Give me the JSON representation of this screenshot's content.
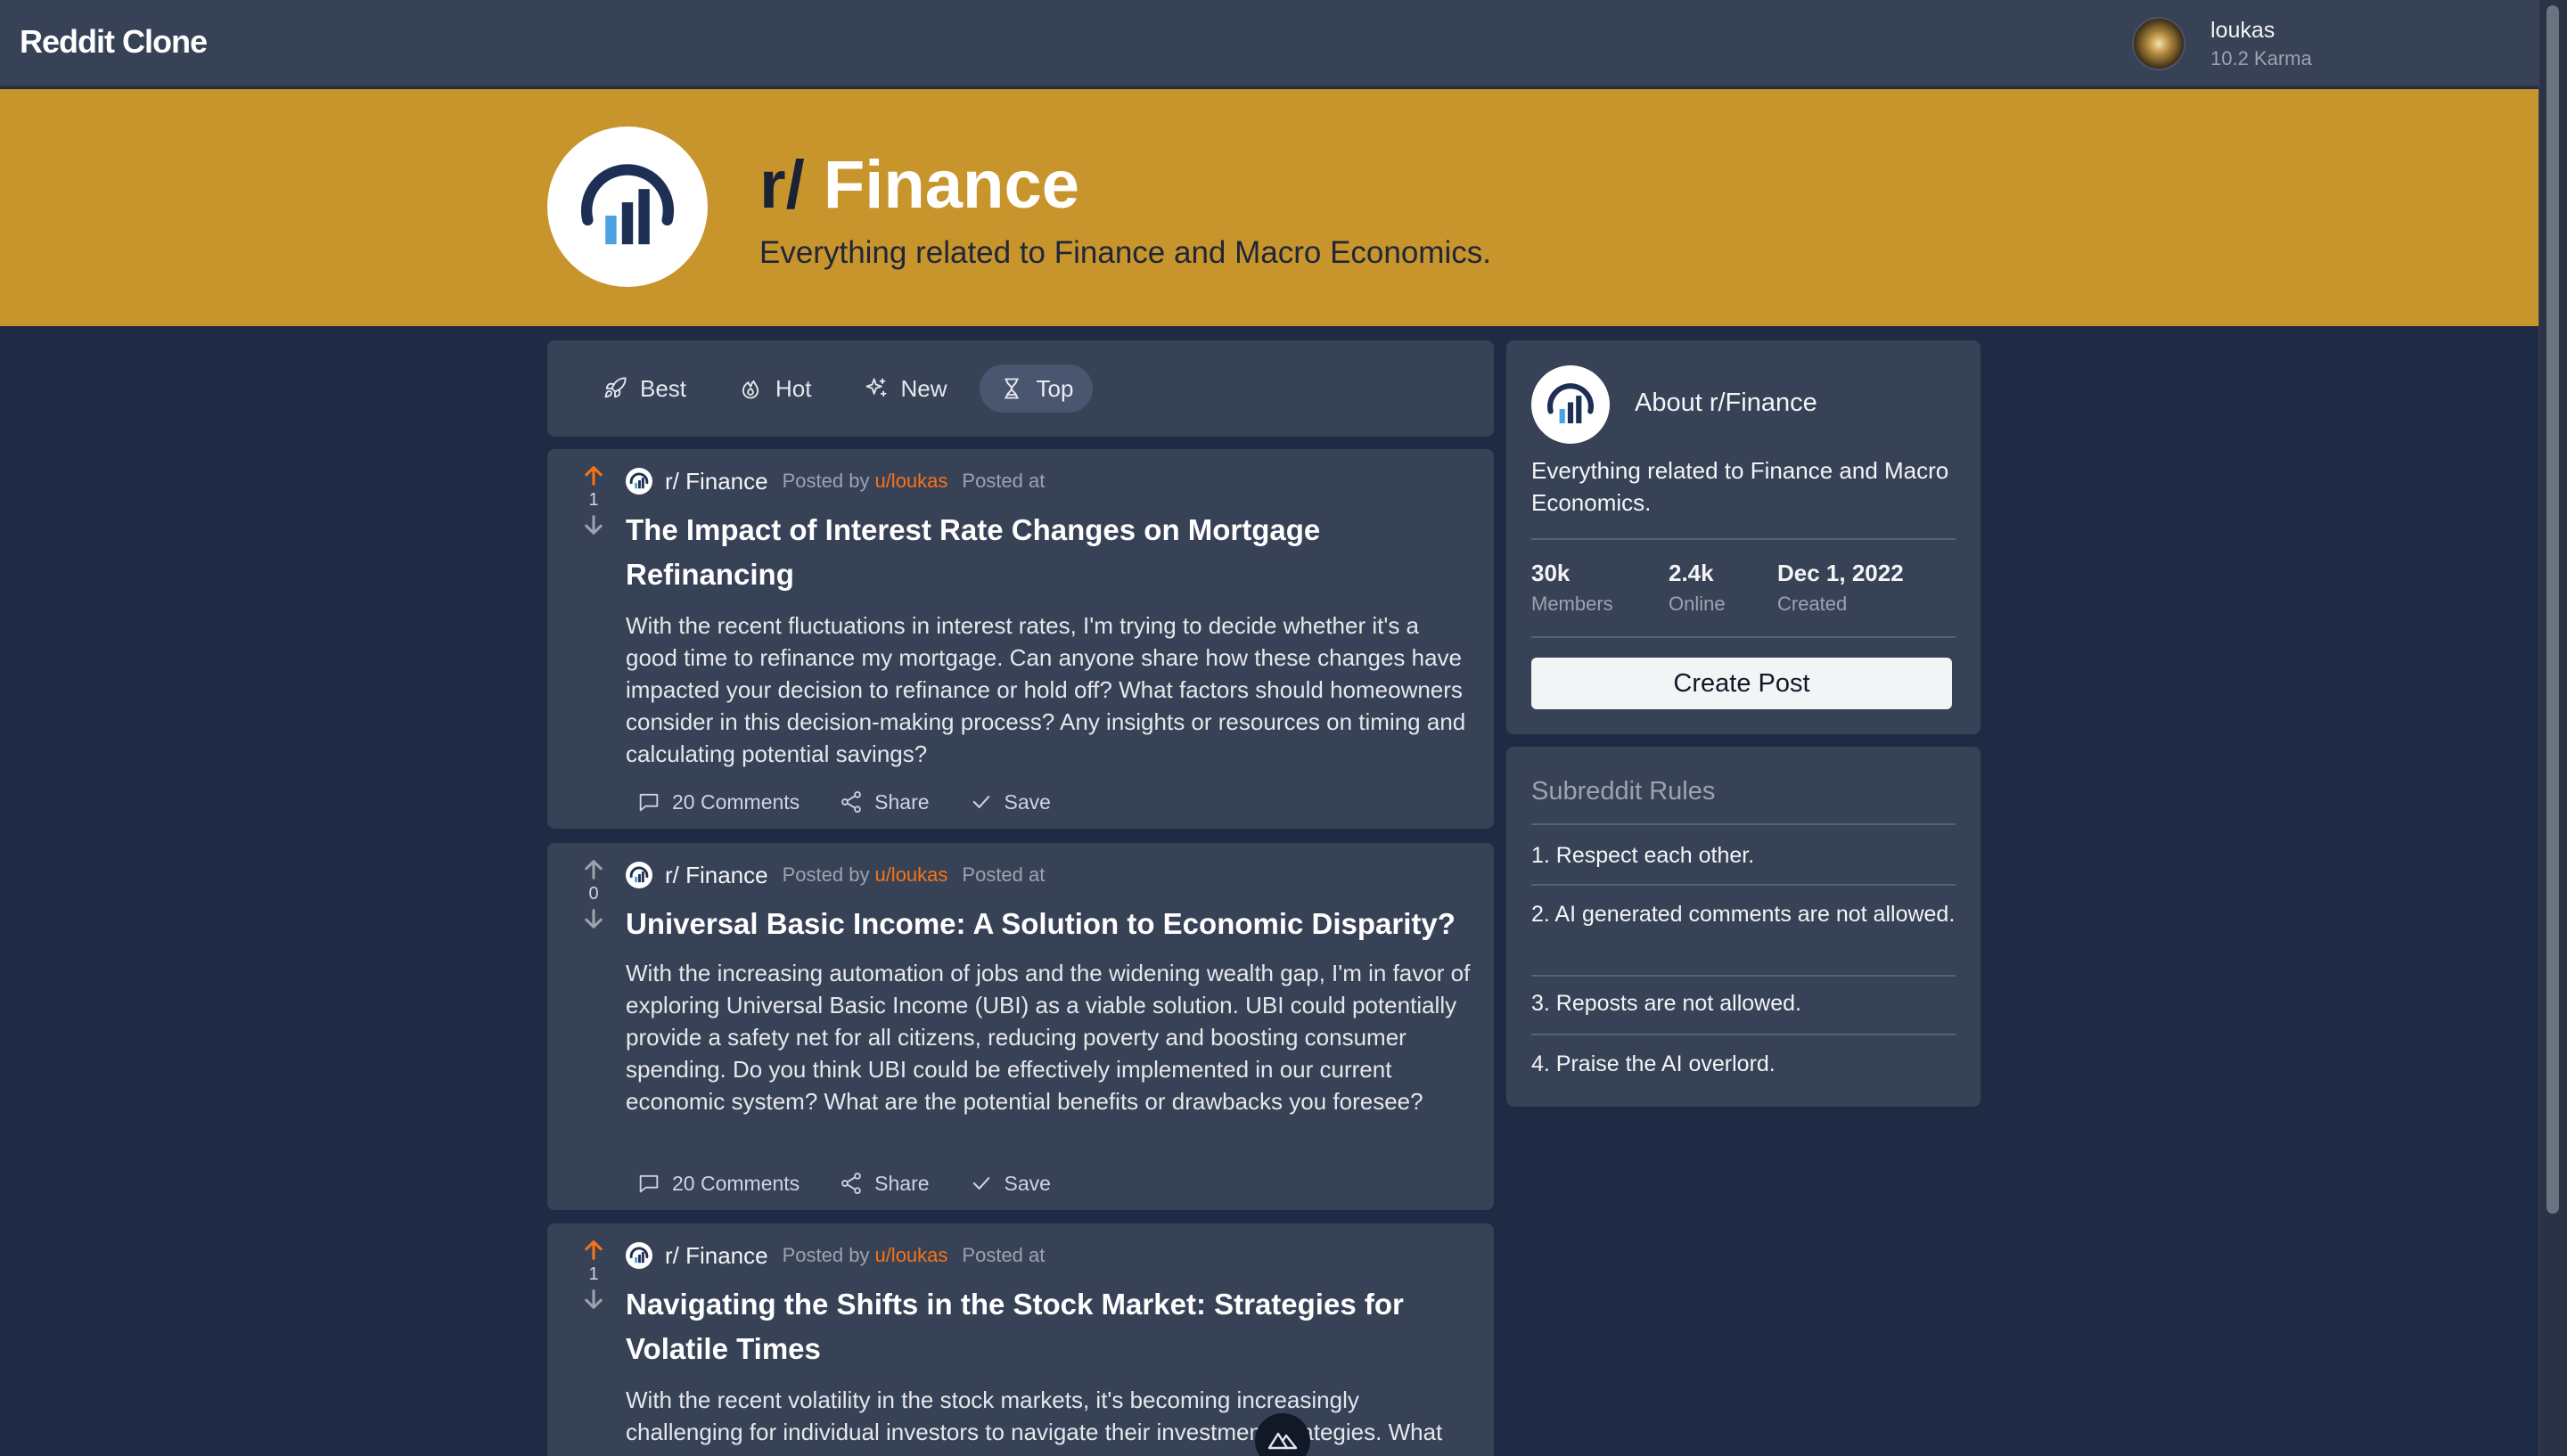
{
  "app": {
    "brand": "Reddit Clone"
  },
  "user": {
    "name": "loukas",
    "karma": "10.2 Karma"
  },
  "subreddit": {
    "prefix": "r/",
    "name": "Finance",
    "description": "Everything related to Finance and Macro Economics."
  },
  "sort": [
    {
      "label": "Best",
      "icon": "rocket-icon",
      "active": false
    },
    {
      "label": "Hot",
      "icon": "flame-icon",
      "active": false
    },
    {
      "label": "New",
      "icon": "sparkles-icon",
      "active": false
    },
    {
      "label": "Top",
      "icon": "hourglass-icon",
      "active": true
    }
  ],
  "posts": [
    {
      "votes": "1",
      "upvoted": true,
      "sub": "r/ Finance",
      "posted_by": "Posted by",
      "user": "u/loukas",
      "posted_at": "Posted at",
      "title": "The Impact of Interest Rate Changes on Mortgage Refinancing",
      "body": "With the recent fluctuations in interest rates, I'm trying to decide whether it's a good time to refinance my mortgage. Can anyone share how these changes have impacted your decision to refinance or hold off? What factors should homeowners consider in this decision-making process? Any insights or resources on timing and calculating potential savings?",
      "comments": "20 Comments",
      "share": "Share",
      "save": "Save"
    },
    {
      "votes": "0",
      "upvoted": false,
      "sub": "r/ Finance",
      "posted_by": "Posted by",
      "user": "u/loukas",
      "posted_at": "Posted at",
      "title": "Universal Basic Income: A Solution to Economic Disparity?",
      "body": "With the increasing automation of jobs and the widening wealth gap, I'm in favor of exploring Universal Basic Income (UBI) as a viable solution. UBI could potentially provide a safety net for all citizens, reducing poverty and boosting consumer spending. Do you think UBI could be effectively implemented in our current economic system? What are the potential benefits or drawbacks you foresee?",
      "comments": "20 Comments",
      "share": "Share",
      "save": "Save"
    },
    {
      "votes": "1",
      "upvoted": true,
      "sub": "r/ Finance",
      "posted_by": "Posted by",
      "user": "u/loukas",
      "posted_at": "Posted at",
      "title": "Navigating the Shifts in the Stock Market: Strategies for Volatile Times",
      "body": "With the recent volatility in the stock markets, it's becoming increasingly challenging for individual investors to navigate their investment strategies. What"
    }
  ],
  "about": {
    "title": "About r/Finance",
    "description": "Everything related to Finance and Macro Economics.",
    "members_value": "30k",
    "members_label": "Members",
    "online_value": "2.4k",
    "online_label": "Online",
    "created_value": "Dec 1, 2022",
    "created_label": "Created",
    "create_post": "Create Post"
  },
  "rules": {
    "title": "Subreddit Rules",
    "items": [
      "1. Respect each other.",
      "2. AI generated comments are not allowed.",
      "3. Reposts are not allowed.",
      "4. Praise the AI overlord."
    ]
  },
  "colors": {
    "banner": "#c8942c",
    "accent_orange": "#f97316",
    "card": "#374257",
    "background": "#1f2a44"
  }
}
